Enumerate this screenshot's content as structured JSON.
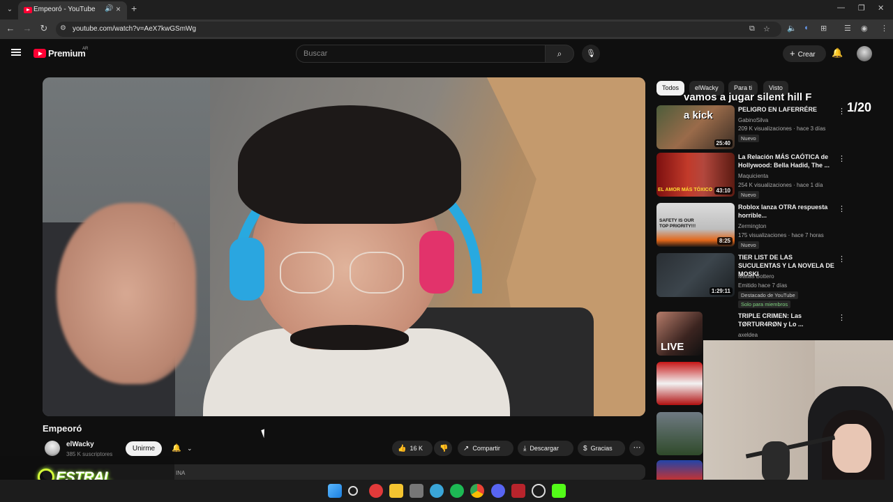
{
  "browser": {
    "tab_title": "Empeoró - YouTube",
    "new_tab": "+",
    "url": "youtube.com/watch?v=AeX7kwGSmWg"
  },
  "header": {
    "brand": "Premium",
    "country": "AR",
    "search_placeholder": "Buscar",
    "create_label": "Crear"
  },
  "video": {
    "title": "Empeoró",
    "channel": "elWacky",
    "subscribers": "385 K suscriptores",
    "join_label": "Unirme",
    "likes": "16 K",
    "share_label": "Compartir",
    "download_label": "Descargar",
    "thanks_label": "Gracias",
    "desc_fragment": "INA"
  },
  "sidebar": {
    "chips": [
      "Todos",
      "elWacky",
      "Para ti",
      "Visto"
    ],
    "overlay_line1": "vamos a jugar silent hill F",
    "overlay_line2": "a kick",
    "counter": "1/20",
    "items": [
      {
        "title": "PELIGRO EN LAFERRÉRE",
        "channel": "GabinoSilva",
        "meta": "209 K visualizaciones · hace 3 días",
        "badge": "Nuevo",
        "duration": "25:40"
      },
      {
        "title": "La Relación MÁS CAÓTICA de Hollywood: Bella Hadid, The ...",
        "channel": "Maquicienta",
        "meta": "254 K visualizaciones · hace 1 día",
        "badge": "Nuevo",
        "duration": "43:10",
        "thumb_text": "EL AMOR MÁS TÓXICO"
      },
      {
        "title": "Roblox lanza OTRA respuesta horrible...",
        "channel": "Zermington",
        "meta": "175 visualizaciones · hace 7 horas",
        "badge": "Nuevo",
        "duration": "8:25",
        "thumb_text": "SAFETY IS OUR TOP PRIORITY!!!"
      },
      {
        "title": "TIER LIST DE LAS SUCULENTAS Y LA NOVELA DE MOSKI",
        "channel": "Matias Bottero",
        "meta": "Emitido hace 7 días",
        "badge": "Destacado de YouTube",
        "badge2": "Solo para miembros",
        "duration": "1:29:11"
      },
      {
        "title": "TRIPLE CRIMEN: Las TØRTUR4RØN y Lo ...",
        "channel": "axeldea",
        "thumb_text": "LIVE"
      }
    ]
  },
  "watermark": {
    "text": "ESTRAL"
  },
  "colors": {
    "yt_red": "#ff0033",
    "bg": "#0f0f0f",
    "chip": "#272727",
    "estral_green": "#b5ff3a"
  }
}
